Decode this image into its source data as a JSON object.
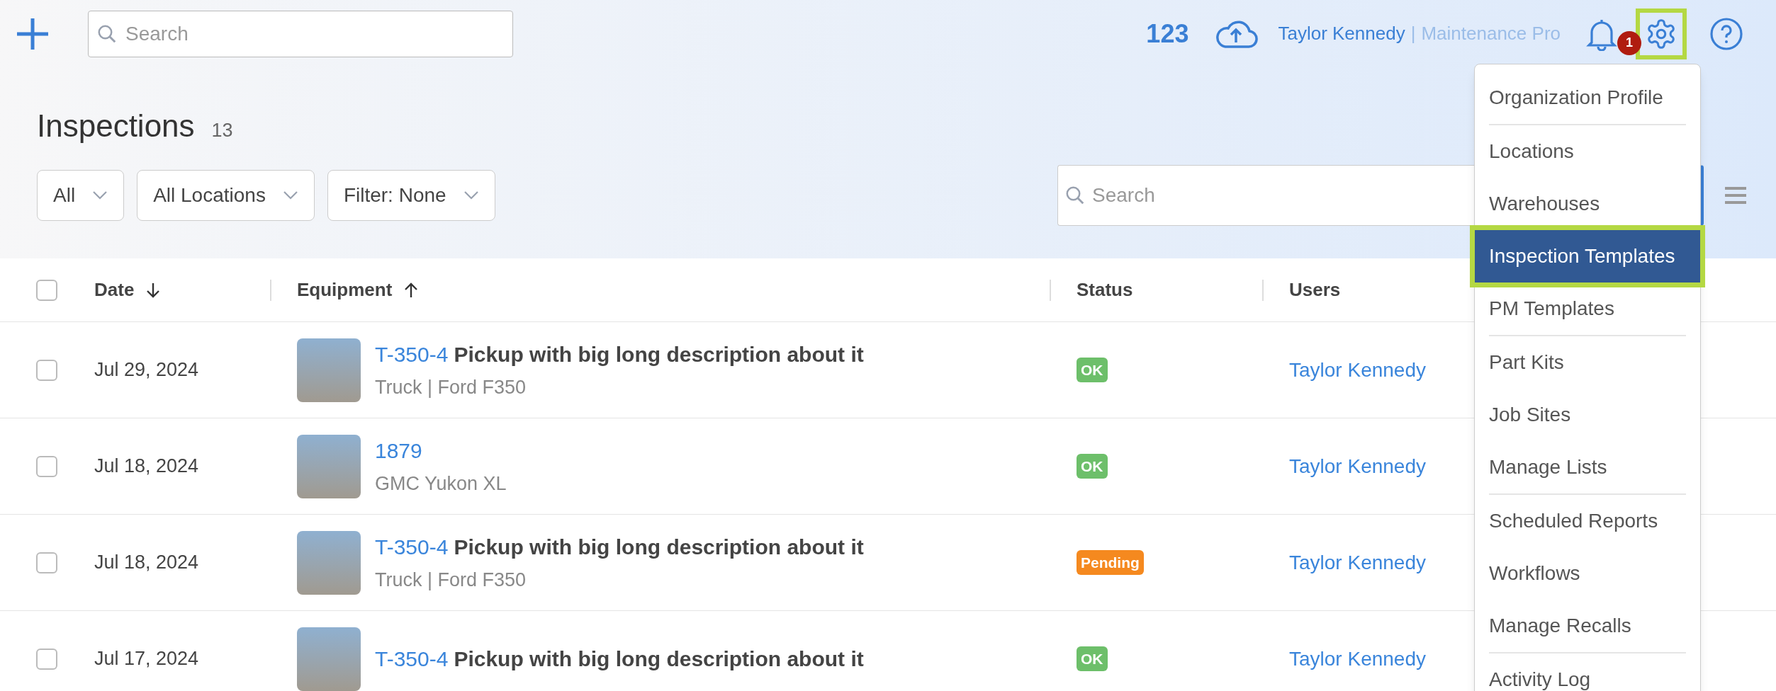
{
  "topbar": {
    "search": {
      "placeholder": "Search"
    },
    "counter": "123",
    "user": "Taylor Kennedy",
    "separator": "|",
    "plan": "Maintenance Pro",
    "notifications": "1",
    "settings_open": true
  },
  "page": {
    "title": "Inspections",
    "count": "13",
    "filters": [
      "All",
      "All Locations",
      "Filter: None"
    ],
    "search": {
      "placeholder": "Search"
    }
  },
  "table": {
    "all_checked": false,
    "columns": [
      {
        "label": "Date",
        "sorted": true,
        "ascending": false
      },
      {
        "label": "Equipment",
        "sorted": true,
        "ascending": true
      },
      {
        "label": "Status",
        "sorted": false
      },
      {
        "label": "Users",
        "sorted": false
      }
    ],
    "rows": [
      {
        "checked": false,
        "date": "Jul 29, 2024",
        "code": "T-350-4",
        "name": "Pickup with big long description about it",
        "detail": "Truck | Ford F350",
        "status": "OK",
        "color": "#6dbf6a",
        "user": "Taylor Kennedy"
      },
      {
        "checked": false,
        "date": "Jul 18, 2024",
        "code": "1879",
        "detail": "GMC Yukon XL",
        "status": "OK",
        "color": "#6dbf6a",
        "user": "Taylor Kennedy"
      },
      {
        "checked": false,
        "date": "Jul 18, 2024",
        "code": "T-350-4",
        "name": "Pickup with big long description about it",
        "detail": "Truck | Ford F350",
        "status": "Pending",
        "color": "#f5891f",
        "user": "Taylor Kennedy"
      },
      {
        "checked": false,
        "date": "Jul 17, 2024",
        "code": "T-350-4",
        "name": "Pickup with big long description about it",
        "status": "OK",
        "color": "#6dbf6a",
        "user": "Taylor Kennedy"
      }
    ]
  },
  "settings_menu": {
    "groups": [
      [
        {
          "label": "Organization Profile",
          "selected": false
        }
      ],
      [
        {
          "label": "Locations",
          "selected": false
        },
        {
          "label": "Warehouses",
          "selected": false
        },
        {
          "label": "Inspection Templates",
          "selected": true
        },
        {
          "label": "PM Templates",
          "selected": false
        }
      ],
      [
        {
          "label": "Part Kits",
          "selected": false
        },
        {
          "label": "Job Sites",
          "selected": false
        },
        {
          "label": "Manage Lists",
          "selected": false
        }
      ],
      [
        {
          "label": "Scheduled Reports",
          "selected": false
        },
        {
          "label": "Workflows",
          "selected": false
        },
        {
          "label": "Manage Recalls",
          "selected": false
        }
      ],
      [
        {
          "label": "Activity Log",
          "selected": false
        }
      ]
    ]
  }
}
